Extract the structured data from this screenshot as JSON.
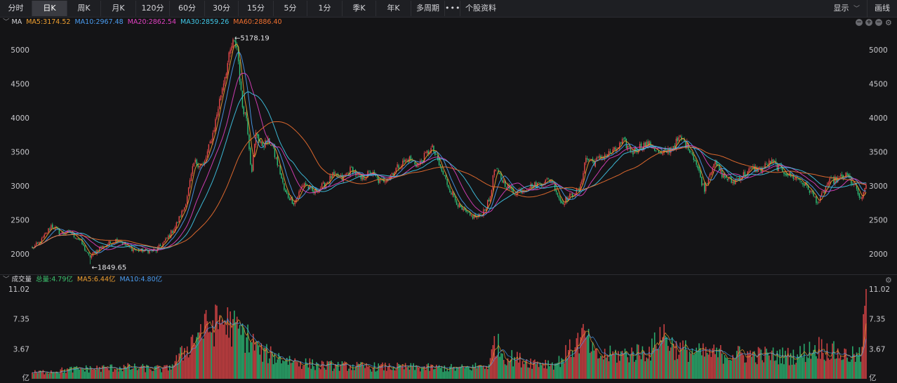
{
  "toolbar": {
    "buttons": [
      {
        "label": "分时",
        "active": false
      },
      {
        "label": "日K",
        "active": true
      },
      {
        "label": "周K",
        "active": false
      },
      {
        "label": "月K",
        "active": false
      },
      {
        "label": "120分",
        "active": false
      },
      {
        "label": "60分",
        "active": false
      },
      {
        "label": "30分",
        "active": false
      },
      {
        "label": "15分",
        "active": false
      },
      {
        "label": "5分",
        "active": false
      },
      {
        "label": "1分",
        "active": false
      },
      {
        "label": "季K",
        "active": false
      },
      {
        "label": "年K",
        "active": false
      },
      {
        "label": "多周期",
        "active": false
      }
    ],
    "more_label": "•••",
    "stock_info_label": "个股资料",
    "display_label": "显示",
    "draw_label": "画线"
  },
  "price_panel": {
    "indicator": "MA",
    "ma": [
      {
        "label": "MA5:3174.52",
        "color": "#f0a030"
      },
      {
        "label": "MA10:2967.48",
        "color": "#4a9cf0"
      },
      {
        "label": "MA20:2862.54",
        "color": "#e040c0"
      },
      {
        "label": "MA30:2859.26",
        "color": "#40c8e8"
      },
      {
        "label": "MA60:2886.40",
        "color": "#f07030"
      }
    ],
    "high_label": "←5178.19",
    "low_label": "←1849.65"
  },
  "volume_panel": {
    "title": "成交量",
    "items": [
      {
        "label": "总量:4.79亿",
        "color": "#3cc46e"
      },
      {
        "label": "MA5:6.44亿",
        "color": "#f0a030"
      },
      {
        "label": "MA10:4.80亿",
        "color": "#4a9cf0"
      }
    ]
  },
  "chart_data": [
    {
      "type": "candlestick",
      "ylim": [
        1849.65,
        5178.19
      ],
      "ytick_labels": [
        "5000",
        "4500",
        "4000",
        "3500",
        "3000",
        "2500",
        "2000"
      ],
      "right_ytick_labels": [
        "5000",
        "4500",
        "4000",
        "3500",
        "3000",
        "2500",
        "2000"
      ],
      "annotations": [
        {
          "text": "←5178.19",
          "value": 5178.19
        },
        {
          "text": "←1849.65",
          "value": 1849.65
        }
      ],
      "series": [
        {
          "name": "MA5",
          "last": 3174.52
        },
        {
          "name": "MA10",
          "last": 2967.48
        },
        {
          "name": "MA20",
          "last": 2862.54
        },
        {
          "name": "MA30",
          "last": 2859.26
        },
        {
          "name": "MA60",
          "last": 2886.4
        }
      ],
      "close_trend": [
        [
          0,
          2080
        ],
        [
          2,
          2200
        ],
        [
          4,
          2420
        ],
        [
          6,
          2300
        ],
        [
          8,
          2320
        ],
        [
          10,
          2200
        ],
        [
          12,
          1950
        ],
        [
          14,
          2080
        ],
        [
          16,
          2150
        ],
        [
          18,
          2220
        ],
        [
          20,
          2100
        ],
        [
          22,
          2050
        ],
        [
          24,
          2050
        ],
        [
          26,
          2050
        ],
        [
          28,
          2200
        ],
        [
          30,
          2400
        ],
        [
          32,
          2700
        ],
        [
          34,
          3350
        ],
        [
          36,
          3300
        ],
        [
          38,
          3800
        ],
        [
          40,
          4500
        ],
        [
          42,
          5100
        ],
        [
          43,
          5050
        ],
        [
          44,
          4200
        ],
        [
          45,
          4000
        ],
        [
          46,
          3200
        ],
        [
          47,
          3800
        ],
        [
          48,
          3600
        ],
        [
          50,
          3650
        ],
        [
          52,
          3200
        ],
        [
          53,
          2900
        ],
        [
          55,
          2750
        ],
        [
          57,
          3050
        ],
        [
          59,
          2900
        ],
        [
          61,
          3000
        ],
        [
          63,
          3150
        ],
        [
          65,
          3100
        ],
        [
          67,
          3250
        ],
        [
          69,
          3100
        ],
        [
          71,
          3200
        ],
        [
          73,
          3050
        ],
        [
          75,
          3150
        ],
        [
          77,
          3300
        ],
        [
          79,
          3400
        ],
        [
          81,
          3300
        ],
        [
          83,
          3500
        ],
        [
          84,
          3550
        ],
        [
          86,
          3200
        ],
        [
          88,
          2900
        ],
        [
          90,
          2650
        ],
        [
          92,
          2550
        ],
        [
          94,
          2550
        ],
        [
          96,
          2800
        ],
        [
          97,
          3250
        ],
        [
          99,
          3050
        ],
        [
          101,
          2900
        ],
        [
          103,
          2950
        ],
        [
          105,
          3000
        ],
        [
          107,
          3050
        ],
        [
          109,
          3100
        ],
        [
          111,
          2750
        ],
        [
          113,
          2850
        ],
        [
          115,
          2950
        ],
        [
          116,
          3400
        ],
        [
          118,
          3350
        ],
        [
          120,
          3450
        ],
        [
          122,
          3500
        ],
        [
          124,
          3650
        ],
        [
          126,
          3500
        ],
        [
          128,
          3600
        ],
        [
          130,
          3600
        ],
        [
          132,
          3450
        ],
        [
          134,
          3550
        ],
        [
          136,
          3700
        ],
        [
          138,
          3550
        ],
        [
          139,
          3400
        ],
        [
          141,
          2950
        ],
        [
          143,
          3350
        ],
        [
          145,
          3150
        ],
        [
          147,
          3050
        ],
        [
          149,
          3150
        ],
        [
          151,
          3250
        ],
        [
          153,
          3250
        ],
        [
          155,
          3350
        ],
        [
          157,
          3250
        ],
        [
          159,
          3150
        ],
        [
          161,
          3100
        ],
        [
          163,
          2950
        ],
        [
          165,
          2750
        ],
        [
          167,
          3050
        ],
        [
          169,
          3100
        ],
        [
          171,
          3150
        ],
        [
          173,
          2950
        ],
        [
          174,
          2750
        ],
        [
          175,
          3050
        ]
      ]
    },
    {
      "type": "bar",
      "title": "成交量",
      "unit": "亿",
      "ylim": [
        0,
        11.02
      ],
      "ytick_labels": [
        "11.02",
        "7.35",
        "3.67",
        "亿"
      ],
      "right_ytick_labels": [
        "11.02",
        "7.35",
        "3.67",
        "亿"
      ],
      "series": [
        {
          "name": "总量",
          "last": 4.79
        },
        {
          "name": "MA5",
          "last": 6.44
        },
        {
          "name": "MA10",
          "last": 4.8
        }
      ],
      "volume_trend": [
        [
          0,
          0.8
        ],
        [
          10,
          1.3
        ],
        [
          20,
          1.5
        ],
        [
          28,
          1.3
        ],
        [
          30,
          2.2
        ],
        [
          33,
          4.5
        ],
        [
          35,
          6.3
        ],
        [
          38,
          7.0
        ],
        [
          40,
          7.8
        ],
        [
          42,
          6.8
        ],
        [
          44,
          6.0
        ],
        [
          46,
          5.0
        ],
        [
          48,
          3.5
        ],
        [
          52,
          2.8
        ],
        [
          56,
          2.2
        ],
        [
          60,
          1.8
        ],
        [
          70,
          1.6
        ],
        [
          80,
          1.5
        ],
        [
          90,
          1.4
        ],
        [
          96,
          1.8
        ],
        [
          97,
          5.2
        ],
        [
          99,
          3.0
        ],
        [
          105,
          2.2
        ],
        [
          110,
          2.0
        ],
        [
          116,
          5.8
        ],
        [
          118,
          3.0
        ],
        [
          125,
          3.3
        ],
        [
          130,
          3.8
        ],
        [
          132,
          6.3
        ],
        [
          135,
          4.0
        ],
        [
          140,
          3.4
        ],
        [
          150,
          3.2
        ],
        [
          160,
          3.0
        ],
        [
          165,
          4.2
        ],
        [
          170,
          3.2
        ],
        [
          174,
          3.0
        ],
        [
          175,
          11.02
        ]
      ]
    }
  ]
}
